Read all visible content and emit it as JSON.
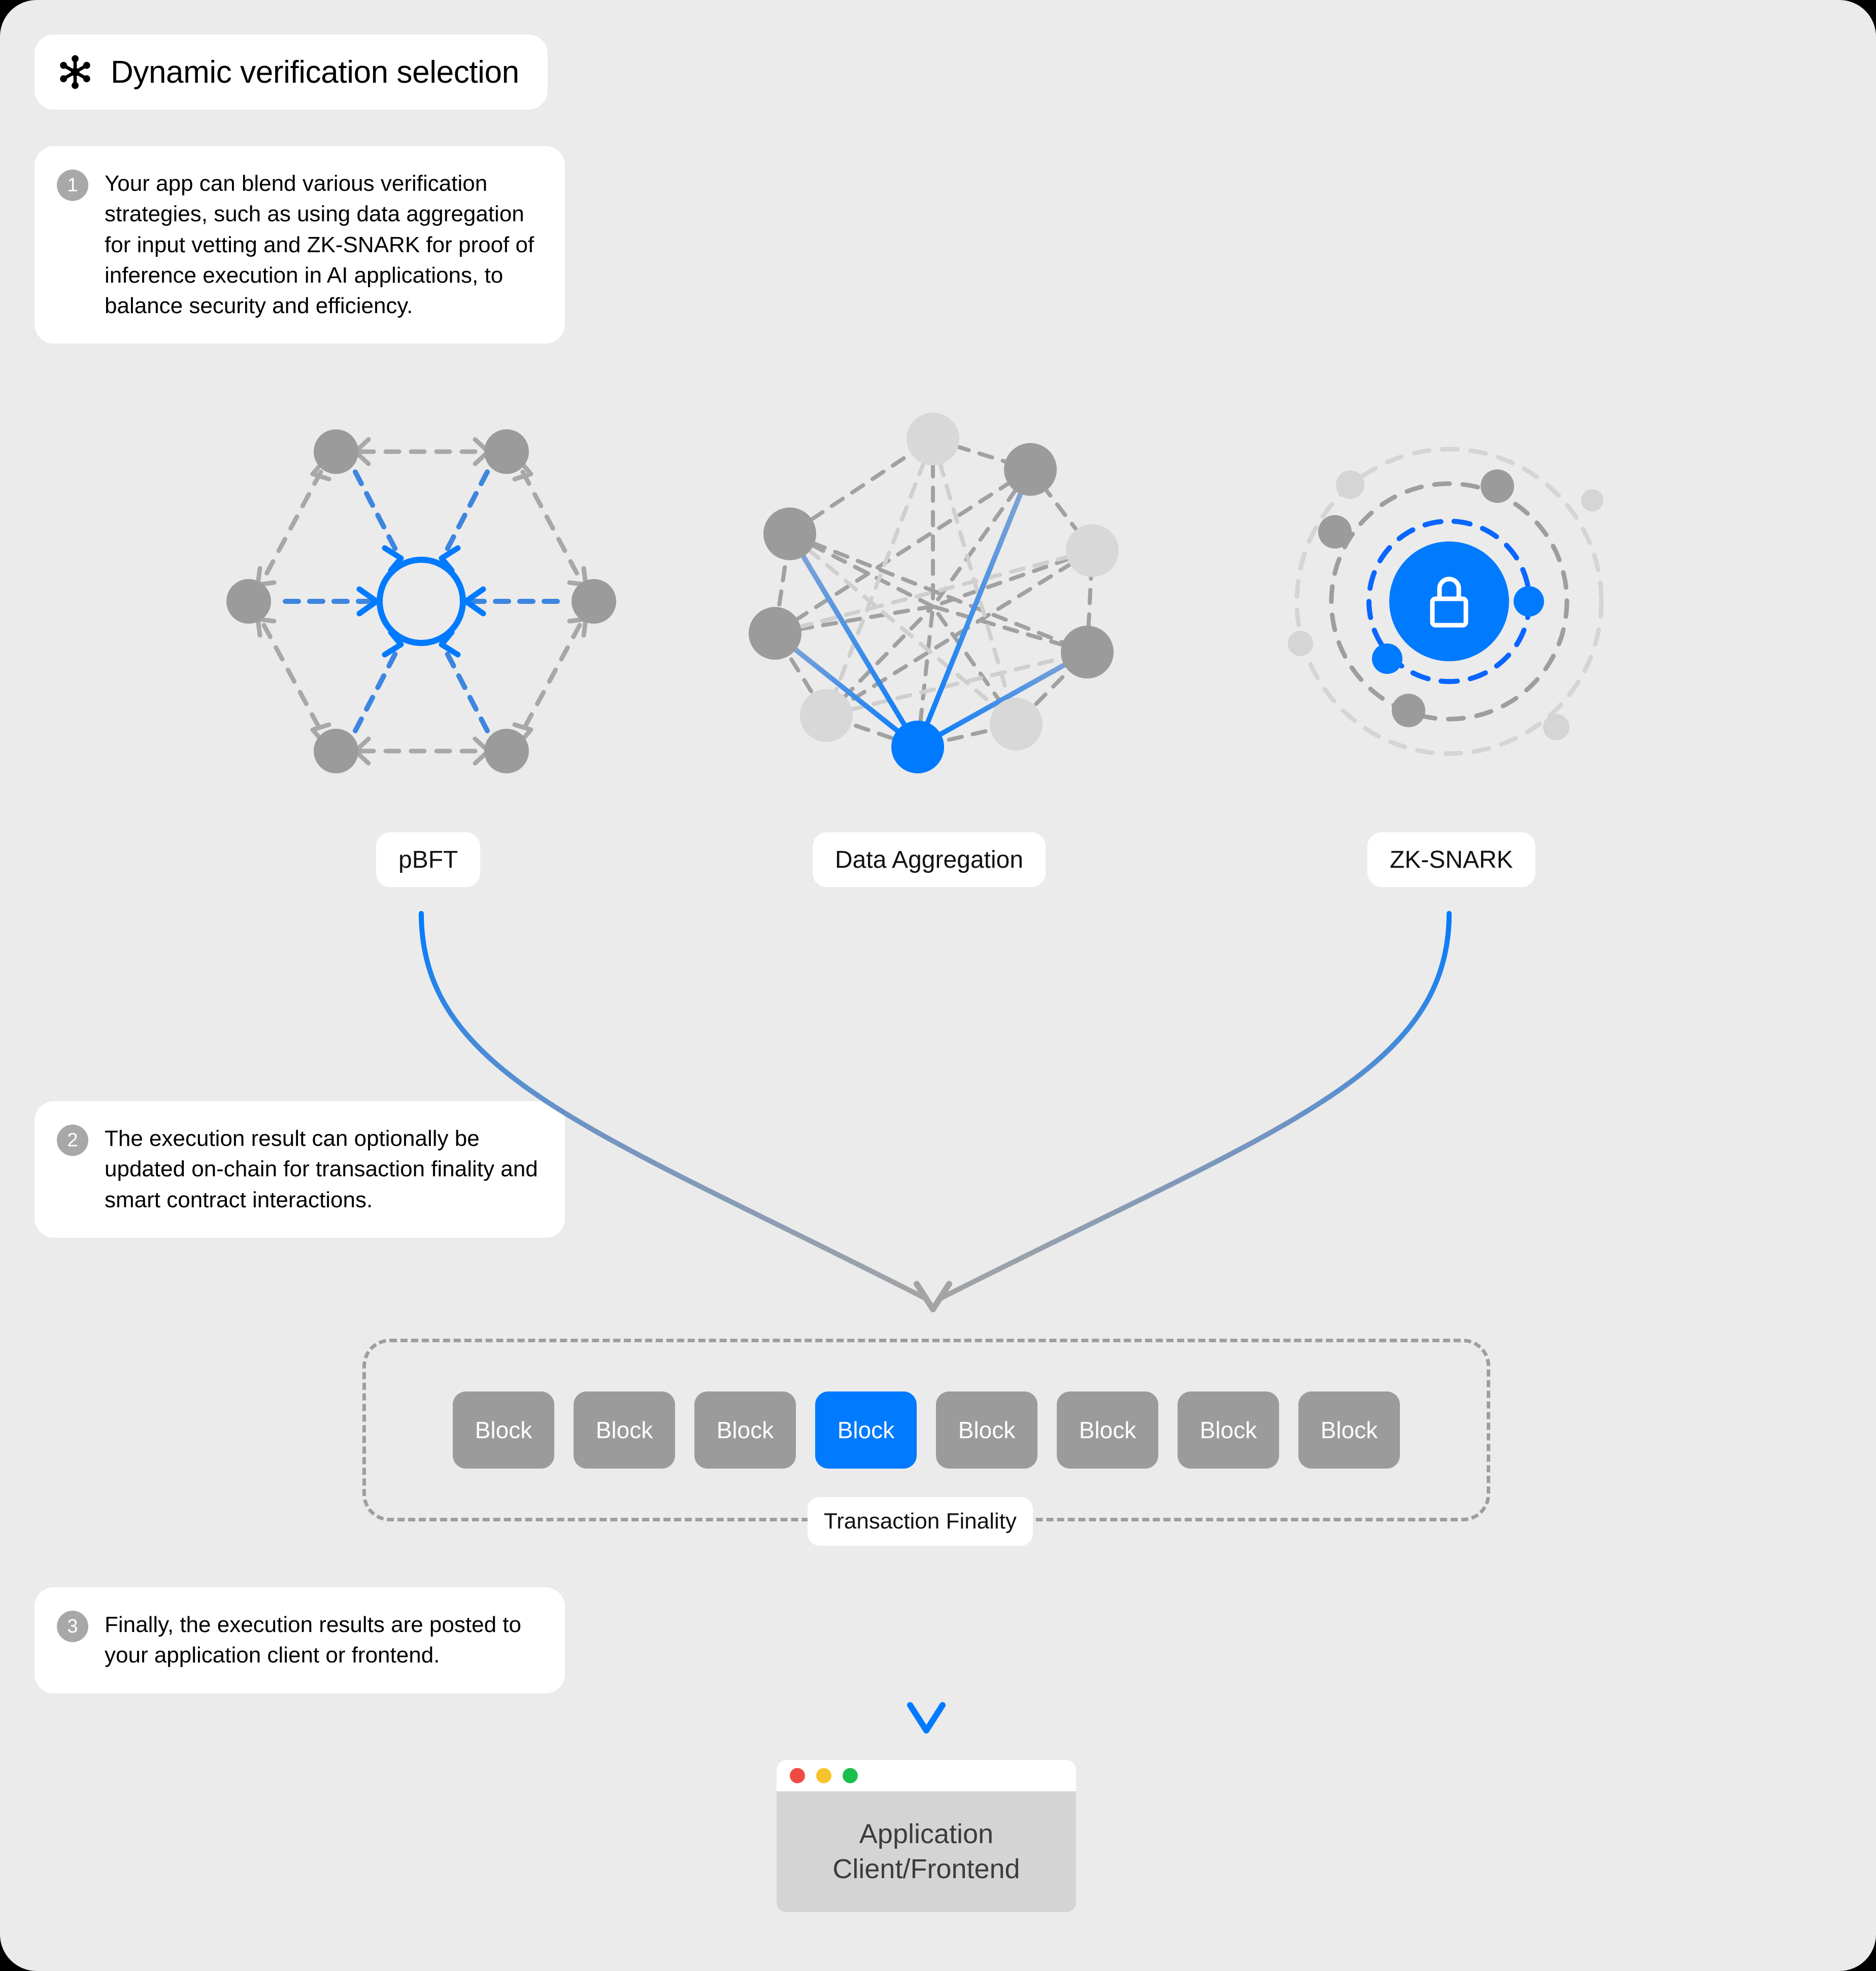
{
  "header": {
    "title": "Dynamic verification selection",
    "icon": "hub-asterisk-icon"
  },
  "callouts": [
    {
      "number": "1",
      "text": "Your app can blend various verification strategies, such as using data aggregation for input vetting and ZK-SNARK for proof of inference execution in AI applications, to balance security and efficiency."
    },
    {
      "number": "2",
      "text": "The execution result can optionally be updated on-chain for transaction finality and smart contract interactions."
    },
    {
      "number": "3",
      "text": "Finally, the execution results are posted to your application client or frontend."
    }
  ],
  "methods": [
    {
      "id": "pbft",
      "label": "pBFT",
      "diagram": "hexagon-consensus-diagram"
    },
    {
      "id": "data-aggregation",
      "label": "Data Aggregation",
      "diagram": "mesh-network-diagram"
    },
    {
      "id": "zk-snark",
      "label": "ZK-SNARK",
      "diagram": "orbit-lock-diagram"
    }
  ],
  "chain": {
    "blocks": [
      "Block",
      "Block",
      "Block",
      "Block",
      "Block",
      "Block",
      "Block",
      "Block"
    ],
    "active_index": 3,
    "finality_label": "Transaction Finality"
  },
  "client": {
    "title_line_1": "Application",
    "title_line_2": "Client/Frontend",
    "traffic_lights": [
      "#f04b43",
      "#f7c32b",
      "#1bbf4c"
    ]
  },
  "colors": {
    "accent_blue": "#007aff",
    "node_gray": "#9b9b9b",
    "node_light_gray": "#d5d5d5",
    "panel_bg": "#ebebeb",
    "card_bg": "#ffffff",
    "arrow_gray": "#a0a0a0"
  }
}
